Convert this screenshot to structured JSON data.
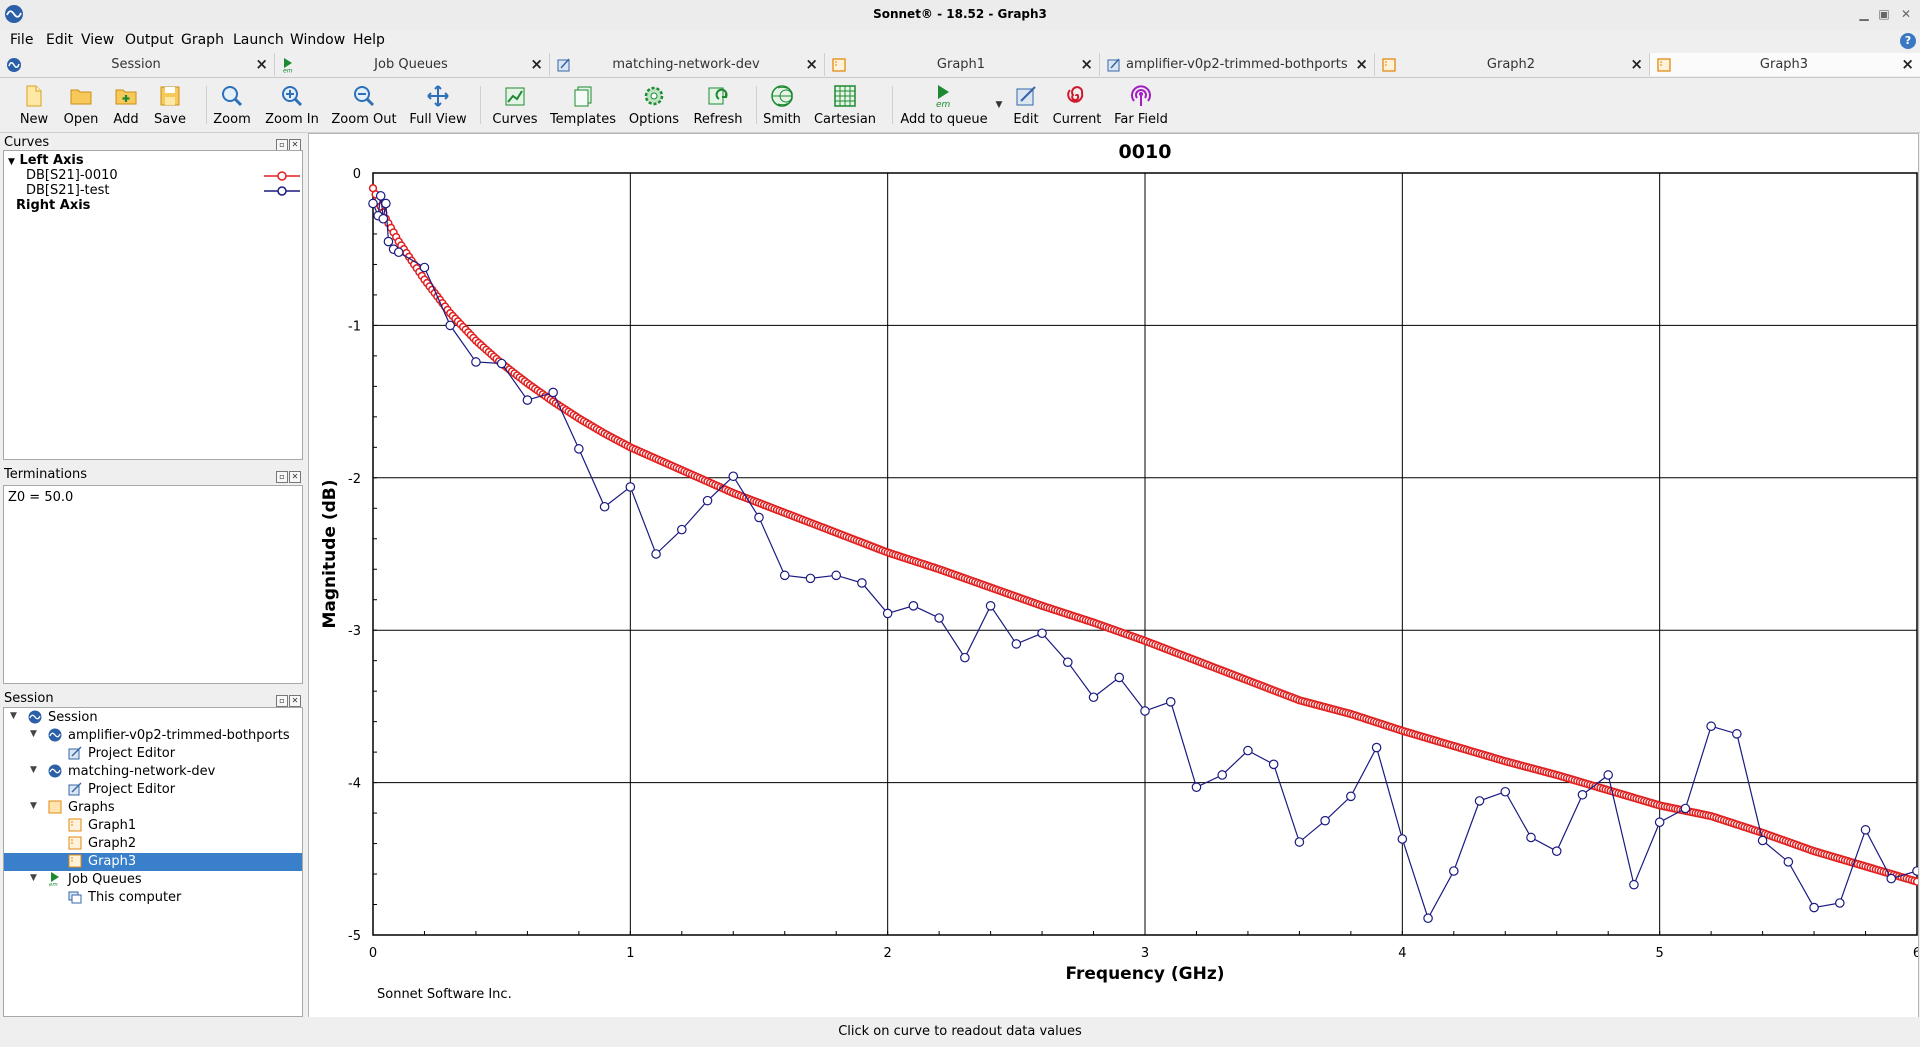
{
  "window": {
    "title": "Sonnet® - 18.52 - Graph3"
  },
  "menu": [
    "File",
    "Edit",
    "View",
    "Output",
    "Graph",
    "Launch",
    "Window",
    "Help"
  ],
  "menu_underline": [
    "F",
    "E",
    "V",
    "O",
    "G",
    "L",
    "W",
    "H"
  ],
  "tabs": [
    {
      "label": "Session",
      "icon": "session-icon"
    },
    {
      "label": "Job Queues",
      "icon": "em-queue-icon"
    },
    {
      "label": "matching-network-dev",
      "icon": "project-editor-icon"
    },
    {
      "label": "Graph1",
      "icon": "graph-icon"
    },
    {
      "label": "amplifier-v0p2-trimmed-bothports",
      "icon": "project-editor-icon"
    },
    {
      "label": "Graph2",
      "icon": "graph-icon"
    },
    {
      "label": "Graph3",
      "icon": "graph-icon",
      "active": true
    }
  ],
  "toolbar": {
    "new": "New",
    "open": "Open",
    "add": "Add",
    "save": "Save",
    "zoom": "Zoom",
    "zoom_in": "Zoom In",
    "zoom_out": "Zoom Out",
    "full_view": "Full View",
    "curves": "Curves",
    "templates": "Templates",
    "options": "Options",
    "refresh": "Refresh",
    "smith": "Smith",
    "cartesian": "Cartesian",
    "add_to_queue": "Add to queue",
    "edit": "Edit",
    "current": "Current",
    "far_field": "Far Field"
  },
  "curves_panel": {
    "title": "Curves",
    "left_axis": "Left Axis",
    "right_axis": "Right Axis",
    "curves": [
      {
        "name": "DB[S21]-0010",
        "color": "#e02020"
      },
      {
        "name": "DB[S21]-test",
        "color": "#1a1a80"
      }
    ]
  },
  "terminations_panel": {
    "title": "Terminations",
    "text": "Z0 = 50.0"
  },
  "session_panel": {
    "title": "Session",
    "items": [
      {
        "label": "Session",
        "icon": "session-icon",
        "arrow": "▼"
      },
      {
        "label": "amplifier-v0p2-trimmed-bothports",
        "icon": "session-icon",
        "arrow": "▼"
      },
      {
        "label": "Project Editor",
        "icon": "project-editor-icon",
        "arrow": ""
      },
      {
        "label": "matching-network-dev",
        "icon": "session-icon",
        "arrow": "▼"
      },
      {
        "label": "Project Editor",
        "icon": "project-editor-icon",
        "arrow": ""
      },
      {
        "label": "Graphs",
        "icon": "graph-folder-icon",
        "arrow": "▼"
      },
      {
        "label": "Graph1",
        "icon": "graph-icon",
        "arrow": ""
      },
      {
        "label": "Graph2",
        "icon": "graph-icon",
        "arrow": ""
      },
      {
        "label": "Graph3",
        "icon": "graph-icon",
        "arrow": "",
        "selected": true
      },
      {
        "label": "Job Queues",
        "icon": "em-queue-icon",
        "arrow": "▼"
      },
      {
        "label": "This computer",
        "icon": "computer-icon",
        "arrow": ""
      }
    ]
  },
  "status": {
    "text": "Click on curve to readout data values"
  },
  "chart_data": {
    "type": "line",
    "title": "0010",
    "xlabel": "Frequency (GHz)",
    "ylabel": "Magnitude (dB)",
    "footer": "Sonnet Software Inc.",
    "xlim": [
      0,
      6
    ],
    "ylim": [
      -5,
      0
    ],
    "xticks": [
      "0",
      "1",
      "2",
      "3",
      "4",
      "5",
      "6"
    ],
    "yticks": [
      "0",
      "-1",
      "-2",
      "-3",
      "-4",
      "-5"
    ],
    "grid": true,
    "series": [
      {
        "name": "DB[S21]-0010",
        "color": "#e02020",
        "marker": "circle",
        "x": [
          0,
          0.05,
          0.1,
          0.2,
          0.3,
          0.4,
          0.5,
          0.6,
          0.7,
          0.8,
          0.9,
          1.0,
          1.2,
          1.4,
          1.6,
          1.8,
          2.0,
          2.2,
          2.4,
          2.6,
          2.8,
          3.0,
          3.2,
          3.4,
          3.6,
          3.8,
          4.0,
          4.2,
          4.4,
          4.6,
          4.8,
          5.0,
          5.2,
          5.4,
          5.6,
          5.8,
          6.0
        ],
        "y": [
          -0.1,
          -0.3,
          -0.45,
          -0.7,
          -0.92,
          -1.1,
          -1.25,
          -1.38,
          -1.5,
          -1.61,
          -1.71,
          -1.8,
          -1.95,
          -2.1,
          -2.23,
          -2.36,
          -2.49,
          -2.6,
          -2.72,
          -2.84,
          -2.95,
          -3.07,
          -3.2,
          -3.33,
          -3.46,
          -3.55,
          -3.66,
          -3.76,
          -3.86,
          -3.95,
          -4.05,
          -4.15,
          -4.22,
          -4.33,
          -4.45,
          -4.55,
          -4.65
        ]
      },
      {
        "name": "DB[S21]-test",
        "color": "#1a1a80",
        "marker": "open-circle",
        "x": [
          0,
          0.02,
          0.03,
          0.04,
          0.05,
          0.06,
          0.08,
          0.1,
          0.2,
          0.3,
          0.4,
          0.5,
          0.6,
          0.7,
          0.8,
          0.9,
          1.0,
          1.1,
          1.2,
          1.3,
          1.4,
          1.5,
          1.6,
          1.7,
          1.8,
          1.9,
          2.0,
          2.1,
          2.2,
          2.3,
          2.4,
          2.5,
          2.6,
          2.7,
          2.8,
          2.9,
          3.0,
          3.1,
          3.2,
          3.3,
          3.4,
          3.5,
          3.6,
          3.7,
          3.8,
          3.9,
          4.0,
          4.1,
          4.2,
          4.3,
          4.4,
          4.5,
          4.6,
          4.7,
          4.8,
          4.9,
          5.0,
          5.1,
          5.2,
          5.3,
          5.4,
          5.5,
          5.6,
          5.7,
          5.8,
          5.9,
          6.0
        ],
        "y": [
          -0.2,
          -0.28,
          -0.15,
          -0.3,
          -0.2,
          -0.45,
          -0.5,
          -0.52,
          -0.62,
          -1.0,
          -1.24,
          -1.25,
          -1.49,
          -1.44,
          -1.81,
          -2.19,
          -2.06,
          -2.5,
          -2.34,
          -2.15,
          -1.99,
          -2.26,
          -2.64,
          -2.66,
          -2.64,
          -2.69,
          -2.89,
          -2.84,
          -2.92,
          -3.18,
          -2.84,
          -3.09,
          -3.02,
          -3.21,
          -3.44,
          -3.31,
          -3.53,
          -3.47,
          -4.03,
          -3.95,
          -3.79,
          -3.88,
          -4.39,
          -4.25,
          -4.09,
          -3.77,
          -4.37,
          -4.89,
          -4.58,
          -4.12,
          -4.06,
          -4.36,
          -4.45,
          -4.08,
          -3.95,
          -4.67,
          -4.26,
          -4.17,
          -3.63,
          -3.68,
          -4.38,
          -4.52,
          -4.82,
          -4.79,
          -4.31,
          -4.63,
          -4.58
        ]
      }
    ]
  }
}
